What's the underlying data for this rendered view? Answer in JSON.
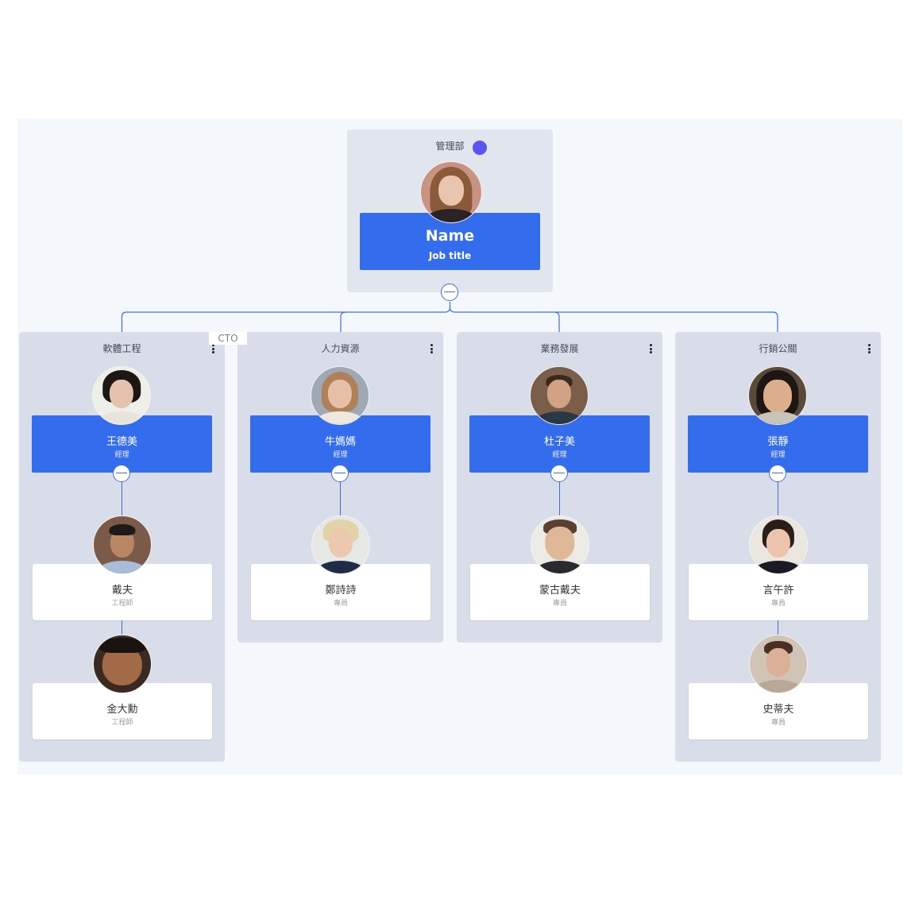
{
  "root": {
    "department": "管理部",
    "name": "Name",
    "job_title": "Job title",
    "avatar_icon": "woman-long-hair-photo",
    "status_dot_color": "#5b54f0",
    "toggle_icon": "collapse-minus-icon"
  },
  "colors": {
    "accent": "#336ded",
    "connector": "#3d6fe0",
    "dept_panel": "#d8dde9",
    "root_panel": "#e1e5ee",
    "canvas": "#f4f7fc"
  },
  "floating_label": "CTO",
  "departments": [
    {
      "label": "軟體工程",
      "manager": {
        "name": "王德美",
        "title": "經理"
      },
      "employees": [
        {
          "name": "戴夫",
          "title": "工程師"
        },
        {
          "name": "金大勳",
          "title": "工程師"
        }
      ]
    },
    {
      "label": "人力資源",
      "manager": {
        "name": "牛媽媽",
        "title": "經理"
      },
      "employees": [
        {
          "name": "鄭詩詩",
          "title": "專員"
        }
      ]
    },
    {
      "label": "業務發展",
      "manager": {
        "name": "杜子美",
        "title": "經理"
      },
      "employees": [
        {
          "name": "蒙古戴夫",
          "title": "專員"
        }
      ]
    },
    {
      "label": "行銷公關",
      "manager": {
        "name": "張靜",
        "title": "經理"
      },
      "employees": [
        {
          "name": "言午許",
          "title": "專員"
        },
        {
          "name": "史蒂夫",
          "title": "專員"
        }
      ]
    }
  ]
}
